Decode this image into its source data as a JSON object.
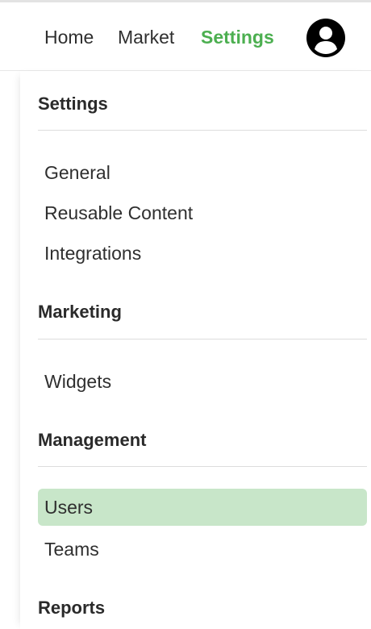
{
  "nav": {
    "links": [
      "Home",
      "Market",
      "Settings"
    ],
    "active": "Settings",
    "avatar_icon": "user-circle-icon"
  },
  "colors": {
    "accent": "#4caf50",
    "active_bg": "#c8e6c9",
    "text": "#2f2f2f"
  },
  "menu": {
    "sections": [
      {
        "title": "Settings",
        "items": [
          "General",
          "Reusable Content",
          "Integrations"
        ]
      },
      {
        "title": "Marketing",
        "items": [
          "Widgets"
        ]
      },
      {
        "title": "Management",
        "items": [
          "Users",
          "Teams"
        ]
      },
      {
        "title": "Reports",
        "items": []
      }
    ],
    "selected": "Users"
  }
}
